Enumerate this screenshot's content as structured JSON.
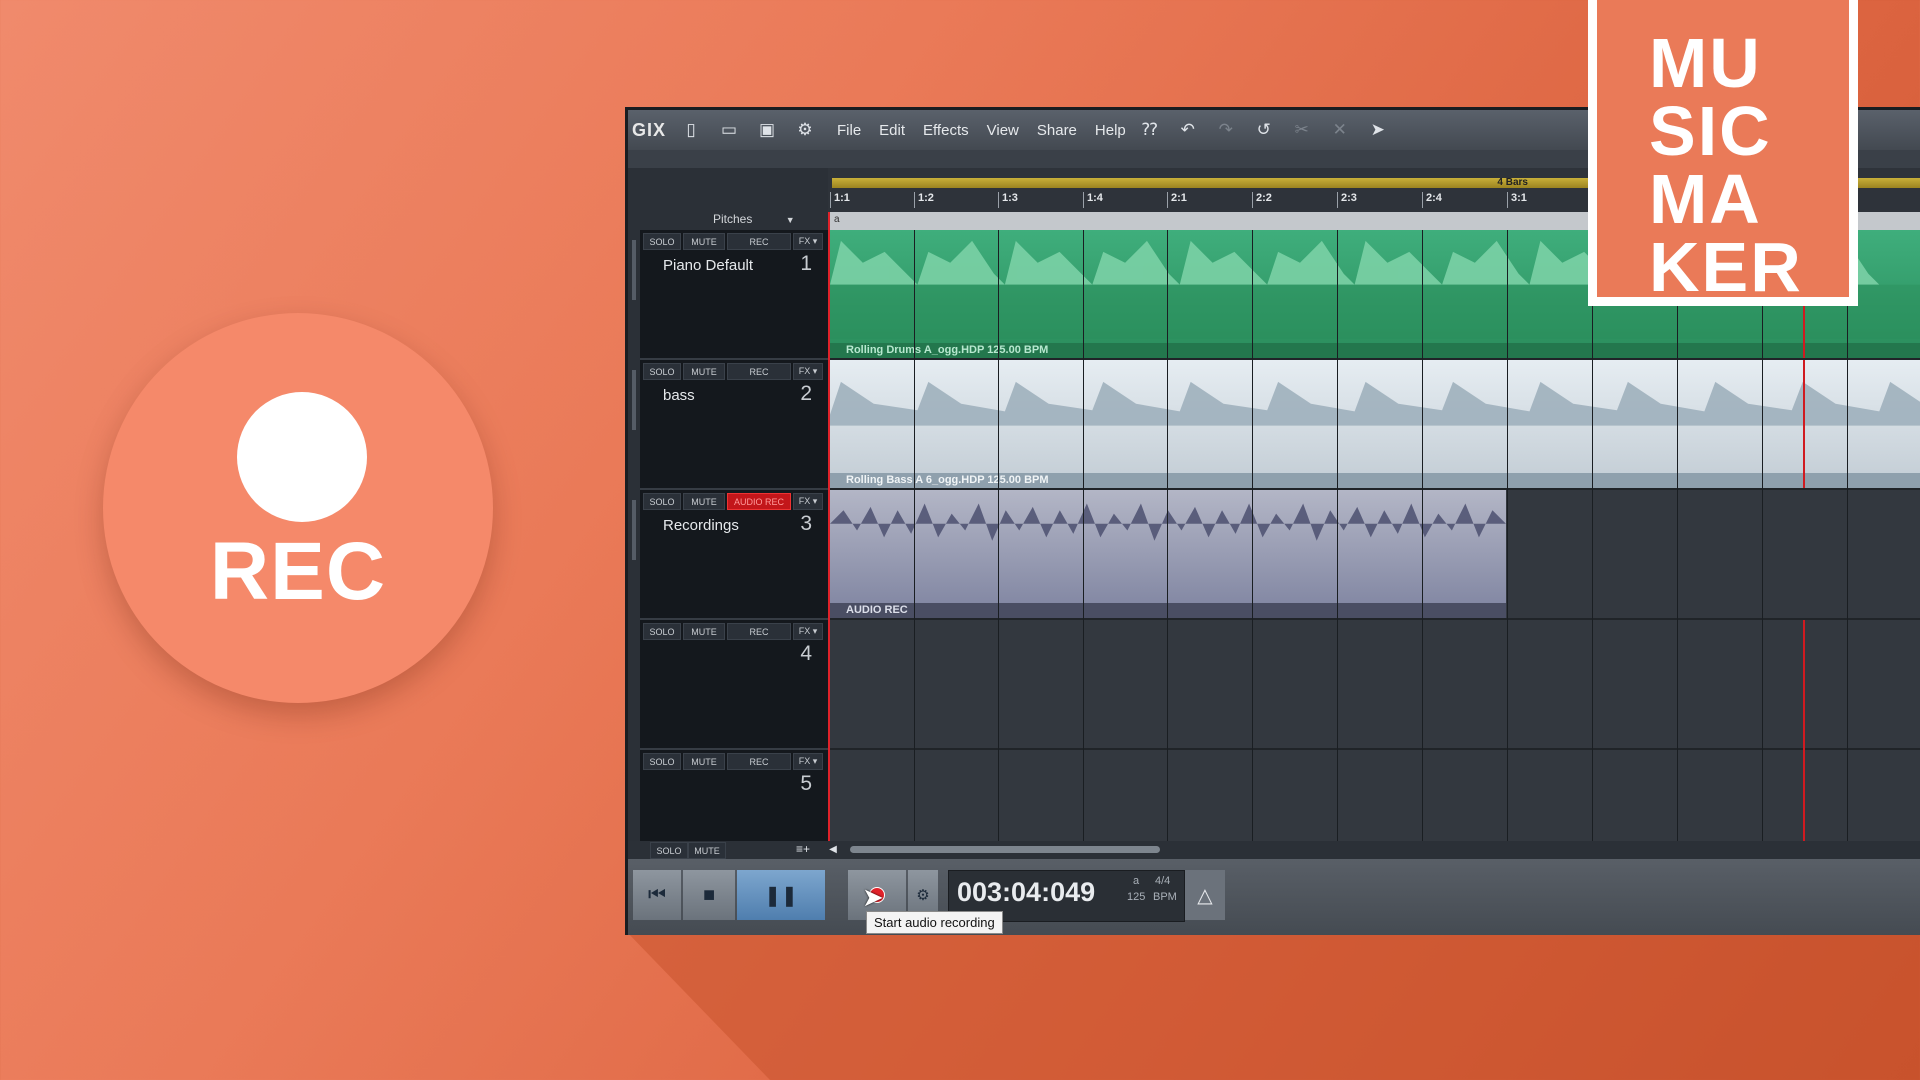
{
  "badge": {
    "label": "REC"
  },
  "logo": {
    "lines": [
      "MU",
      "SIC",
      "MA",
      "KER"
    ]
  },
  "app": {
    "brand": "GIX"
  },
  "menu": [
    "File",
    "Edit",
    "Effects",
    "View",
    "Share",
    "Help"
  ],
  "ruler": {
    "loop_label": "4 Bars",
    "ticks": [
      "1:1",
      "1:2",
      "1:3",
      "1:4",
      "2:1",
      "2:2",
      "2:3",
      "2:4",
      "3:1"
    ]
  },
  "pitches": {
    "label": "Pitches",
    "row_label": "a"
  },
  "track_buttons": {
    "solo": "SOLO",
    "mute": "MUTE",
    "rec": "REC",
    "fx": "FX ▾",
    "audio_rec": "AUDIO REC"
  },
  "tracks": [
    {
      "name": "Piano Default",
      "number": "1"
    },
    {
      "name": "bass",
      "number": "2"
    },
    {
      "name": "Recordings",
      "number": "3"
    },
    {
      "name": "",
      "number": "4"
    },
    {
      "name": "",
      "number": "5"
    }
  ],
  "clips": {
    "drums": "Rolling Drums A_ogg.HDP  125.00 BPM",
    "bass": "Rolling Bass A 6_ogg.HDP  125.00 BPM",
    "rec": "AUDIO REC"
  },
  "bottom": {
    "solo": "SOLO",
    "mute": "MUTE"
  },
  "transport": {
    "time": "003:04:049",
    "key": "a",
    "signature": "4/4",
    "tempo": "125",
    "tempo_unit": "BPM"
  },
  "tooltip": "Start audio recording"
}
